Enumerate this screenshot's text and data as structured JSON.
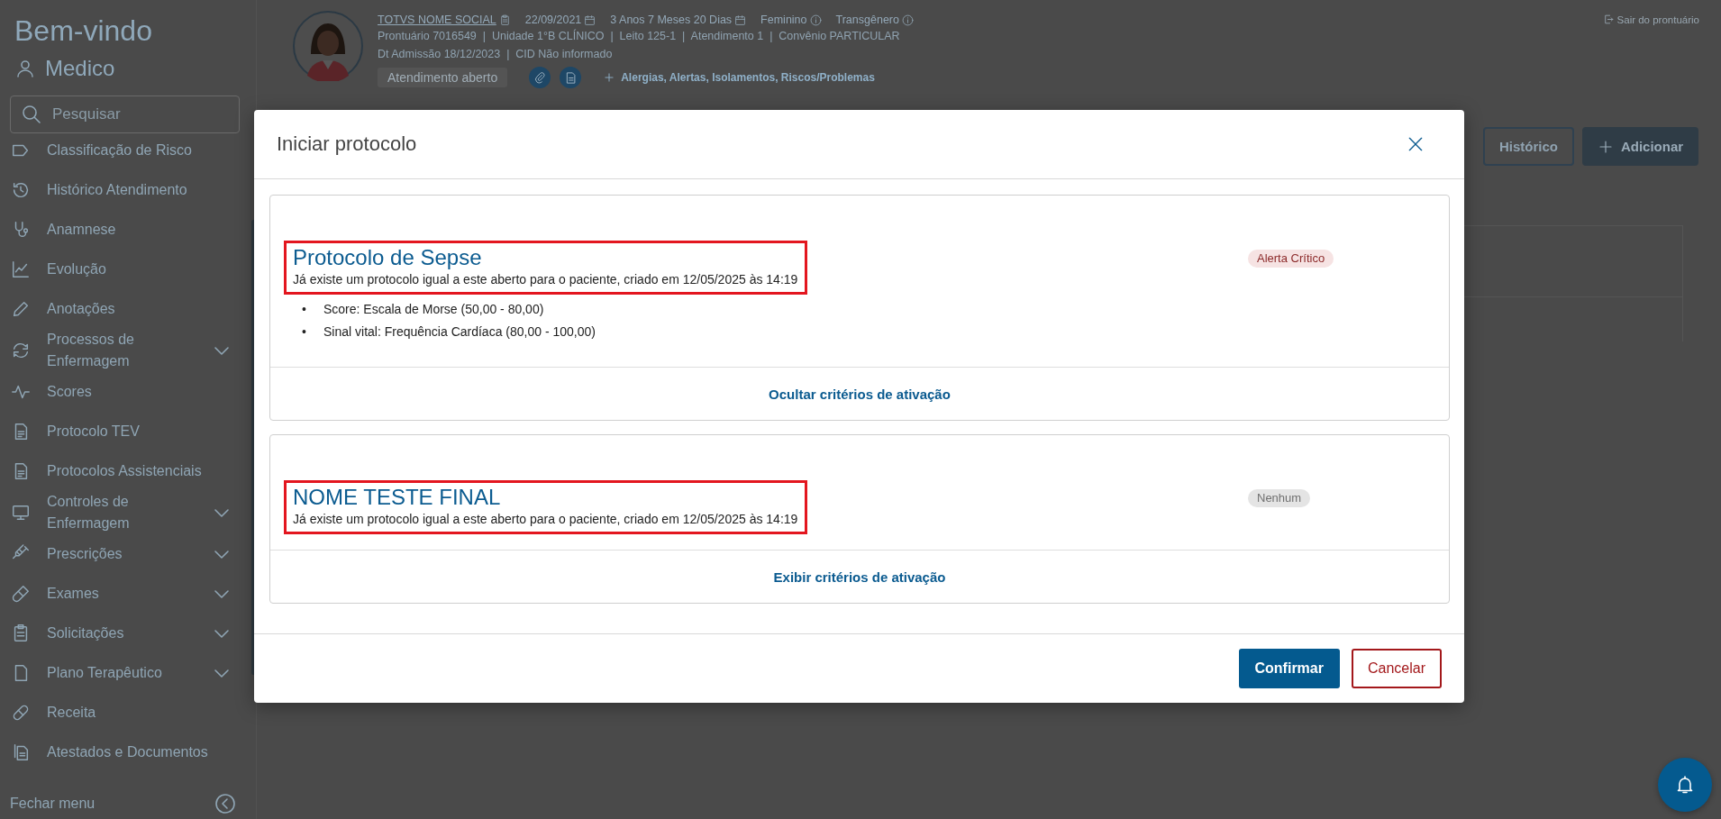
{
  "sidebar": {
    "greeting": "Bem-vindo",
    "user": "Medico",
    "search_placeholder": "Pesquisar",
    "items": [
      {
        "label": "Classificação de Risco",
        "expandable": false
      },
      {
        "label": "Histórico Atendimento",
        "expandable": false
      },
      {
        "label": "Anamnese",
        "expandable": false
      },
      {
        "label": "Evolução",
        "expandable": false
      },
      {
        "label": "Anotações",
        "expandable": false
      },
      {
        "label": "Processos de Enfermagem",
        "expandable": true
      },
      {
        "label": "Scores",
        "expandable": false
      },
      {
        "label": "Protocolo TEV",
        "expandable": false
      },
      {
        "label": "Protocolos Assistenciais",
        "expandable": false
      },
      {
        "label": "Controles de Enfermagem",
        "expandable": true
      },
      {
        "label": "Prescrições",
        "expandable": true
      },
      {
        "label": "Exames",
        "expandable": true
      },
      {
        "label": "Solicitações",
        "expandable": true
      },
      {
        "label": "Plano Terapêutico",
        "expandable": true
      },
      {
        "label": "Receita",
        "expandable": false
      },
      {
        "label": "Atestados e Documentos",
        "expandable": false
      }
    ],
    "collapse_label": "Fechar menu"
  },
  "patient": {
    "name": "TOTVS NOME SOCIAL",
    "birth_date": "22/09/2021",
    "age": "3 Anos 7 Meses 20 Dias",
    "sex": "Feminino",
    "gender": "Transgênero",
    "details": [
      "Prontuário 7016549  |  Unidade 1°B CLÍNICO  |  Leito 125-1  |  Atendimento 1  |  Convênio PARTICULAR",
      "Dt Admissão 18/12/2023  |  CID Não informado"
    ],
    "status": "Atendimento aberto",
    "alerts_link": "Alergias, Alertas, Isolamentos, Riscos/Problemas"
  },
  "exit_link": "Sair do prontuário",
  "toolbar_buttons": [
    {
      "label": "Histórico",
      "kind": "outline"
    },
    {
      "label": "Adicionar",
      "kind": "primary"
    }
  ],
  "modal": {
    "title": "Iniciar protocolo",
    "protocols": [
      {
        "name": "Protocolo de Sepse",
        "message": "Já existe um protocolo igual a este aberto para o paciente, criado em 12/05/2025 às 14:19",
        "highlighted": true,
        "badge": {
          "label": "Alerta Crítico",
          "kind": "critical"
        },
        "criteria_expanded": true,
        "criteria": [
          {
            "bullet": "•",
            "text": "Score: Escala de Morse (50,00 - 80,00)"
          },
          {
            "bullet": "•",
            "text": "Sinal vital: Frequência Cardíaca (80,00 - 100,00)"
          }
        ],
        "toggle_label": "Ocultar critérios de ativação"
      },
      {
        "name": "NOME TESTE FINAL",
        "message": "Já existe um protocolo igual a este aberto para o paciente, criado em 12/05/2025 às 14:19",
        "highlighted": true,
        "badge": {
          "label": "Nenhum",
          "kind": "none"
        },
        "criteria_expanded": false,
        "toggle_label": "Exibir critérios de ativação"
      }
    ],
    "buttons": [
      {
        "label": "Confirmar",
        "kind": "primary"
      },
      {
        "label": "Cancelar",
        "kind": "danger"
      }
    ]
  }
}
